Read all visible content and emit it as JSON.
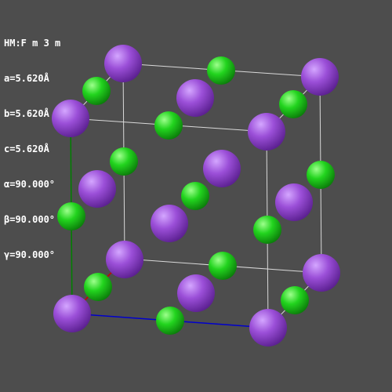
{
  "cell_info": {
    "space_group": "HM:F m 3 m",
    "a": "a=5.620Å",
    "b": "b=5.620Å",
    "c": "c=5.620Å",
    "alpha": "α=90.000°",
    "beta": "β=90.000°",
    "gamma": "γ=90.000°"
  },
  "colors": {
    "background": "#4d4d4d",
    "cell_edge": "#d9d9d9",
    "axis_a": "#cc0000",
    "axis_b": "#008000",
    "axis_c": "#0000cc",
    "atom_purple": "#9b4fd8",
    "atom_green": "#22d41e"
  },
  "atom_types": [
    "purple-atom",
    "green-atom"
  ]
}
